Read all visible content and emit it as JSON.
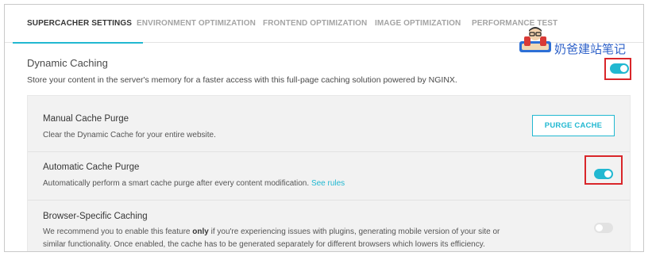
{
  "tabs": [
    {
      "label": "SUPERCACHER SETTINGS",
      "active": true
    },
    {
      "label": "ENVIRONMENT OPTIMIZATION",
      "active": false
    },
    {
      "label": "FRONTEND OPTIMIZATION",
      "active": false
    },
    {
      "label": "IMAGE OPTIMIZATION",
      "active": false
    },
    {
      "label": "PERFORMANCE TEST",
      "active": false
    }
  ],
  "watermark": {
    "text": "奶爸建站笔记"
  },
  "dynamic_caching": {
    "title": "Dynamic Caching",
    "description": "Store your content in the server's memory for a faster access with this full-page caching solution powered by NGINX.",
    "enabled": true
  },
  "manual_purge": {
    "title": "Manual Cache Purge",
    "description": "Clear the Dynamic Cache for your entire website.",
    "button_label": "PURGE CACHE"
  },
  "automatic_purge": {
    "title": "Automatic Cache Purge",
    "description": "Automatically perform a smart cache purge after every content modification.",
    "link_label": "See rules",
    "enabled": true
  },
  "browser_caching": {
    "title": "Browser-Specific Caching",
    "desc_before": "We recommend you to enable this feature ",
    "desc_bold": "only",
    "desc_after": " if you're experiencing issues with plugins, generating mobile version of your site or similar functionality. Once enabled, the cache has to be generated separately for different browsers which lowers its efficiency.",
    "enabled": false
  },
  "colors": {
    "accent": "#22b8d1",
    "highlight_box": "#d9262a",
    "panel_bg": "#f2f2f2"
  }
}
